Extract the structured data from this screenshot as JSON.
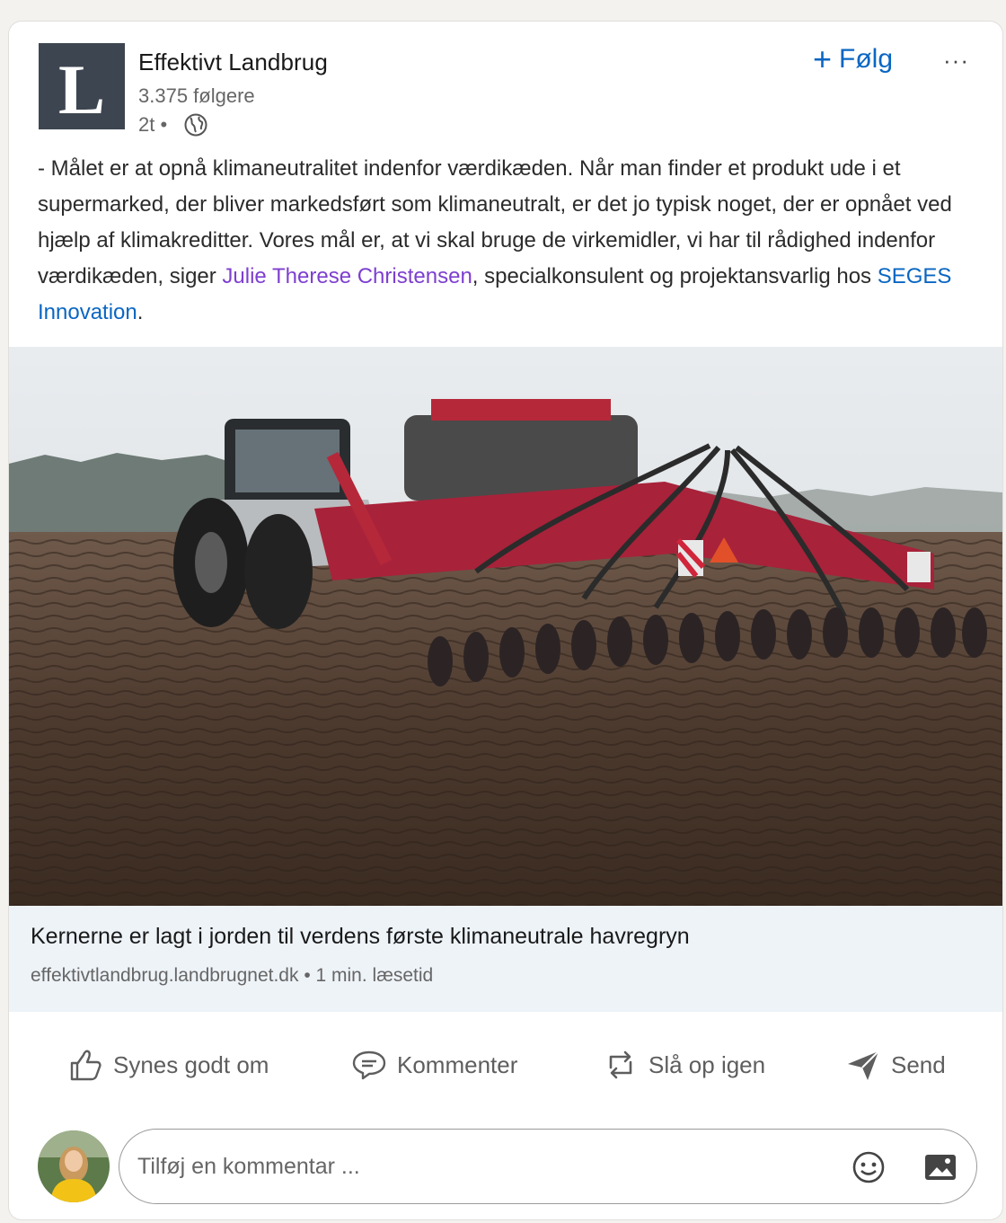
{
  "post": {
    "actor": {
      "name": "Effektivt Landbrug",
      "followers": "3.375 følgere",
      "time": "2t •",
      "visibility_icon": "globe-icon",
      "logo_letter": "L"
    },
    "follow_label": "Følg",
    "more_label": "···",
    "text": {
      "part1": "- Målet er at opnå klimaneutralitet indenfor værdikæden. Når man finder et produkt ude i et supermarked, der bliver markedsført som klimaneutralt, er det jo typisk noget, der er opnået ved hjælp af klimakreditter. Vores mål er, at vi skal bruge de virkemidler, vi har til rådighed indenfor værdikæden, siger ",
      "mention_person": "Julie Therese Christensen",
      "part2": ", specialkonsulent og projektansvarlig hos ",
      "mention_org": "SEGES Innovation",
      "part3": "."
    },
    "link": {
      "title": "Kernerne er lagt i jorden til verdens første klimaneutrale havregryn",
      "meta": "effektivtlandbrug.landbrugnet.dk • 1 min. læsetid"
    },
    "actions": {
      "like": "Synes godt om",
      "comment": "Kommenter",
      "repost": "Slå op igen",
      "send": "Send"
    },
    "comment": {
      "placeholder": "Tilføj en kommentar ..."
    }
  },
  "colors": {
    "accent": "#0a66c2",
    "mention_person": "#7d3fd0",
    "logo_bg": "#3d4550",
    "link_preview_bg": "#eef3f8"
  }
}
